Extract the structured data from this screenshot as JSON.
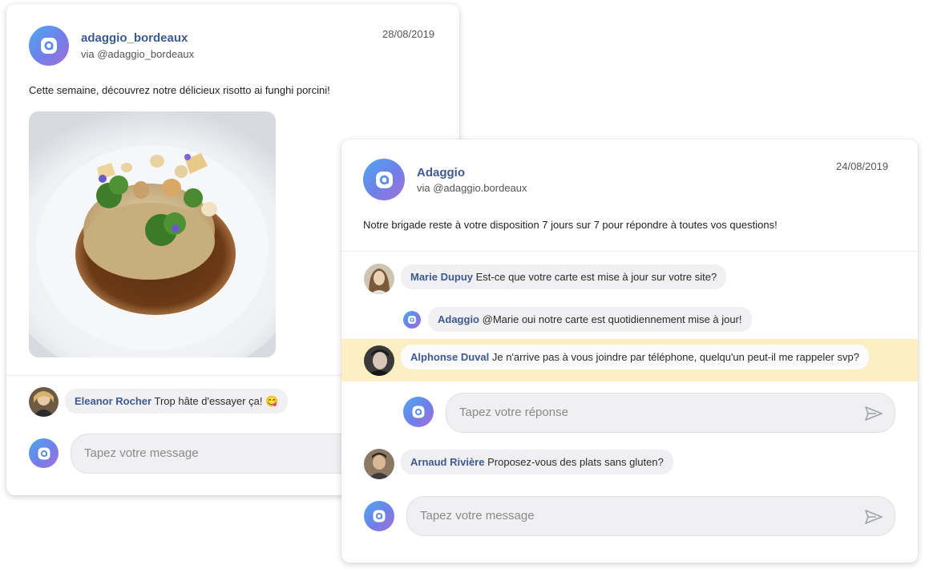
{
  "post1": {
    "author": "adaggio_bordeaux",
    "via": "via @adaggio_bordeaux",
    "date": "28/08/2019",
    "text": "Cette semaine, découvrez notre délicieux risotto ai funghi porcini!",
    "image_icon": "risotto-photo",
    "comment": {
      "name": "Eleanor Rocher",
      "text": "Trop hâte d'essayer ça! 😋"
    },
    "input_placeholder": "Tapez votre message"
  },
  "post2": {
    "author": "Adaggio",
    "via": "via @adaggio.bordeaux",
    "date": "24/08/2019",
    "text": "Notre brigade reste à votre disposition 7 jours sur 7 pour répondre à toutes vos questions!",
    "comments": [
      {
        "name": "Marie Dupuy",
        "text": "Est-ce que votre carte est mise à jour sur votre site?"
      },
      {
        "name": "Adaggio",
        "text": "@Marie oui notre carte est quotidiennement mise à jour!"
      },
      {
        "name": "Alphonse Duval",
        "text": "Je n'arrive pas à vous joindre par téléphone, quelqu'un peut-il me rappeler svp?"
      },
      {
        "name": "Arnaud Rivière",
        "text": "Proposez-vous des plats sans gluten?"
      }
    ],
    "reply_placeholder": "Tapez votre réponse",
    "input_placeholder": "Tapez votre message"
  },
  "colors": {
    "brand_gradient": [
      "#4fa8f0",
      "#6f7fe8",
      "#a86fd8"
    ],
    "name_blue": "#3d5a91",
    "highlight": "#fdefc4",
    "bubble": "#f0f0f2"
  },
  "icons": [
    "adaggio-logo-icon",
    "send-icon",
    "smiley-emoji"
  ]
}
